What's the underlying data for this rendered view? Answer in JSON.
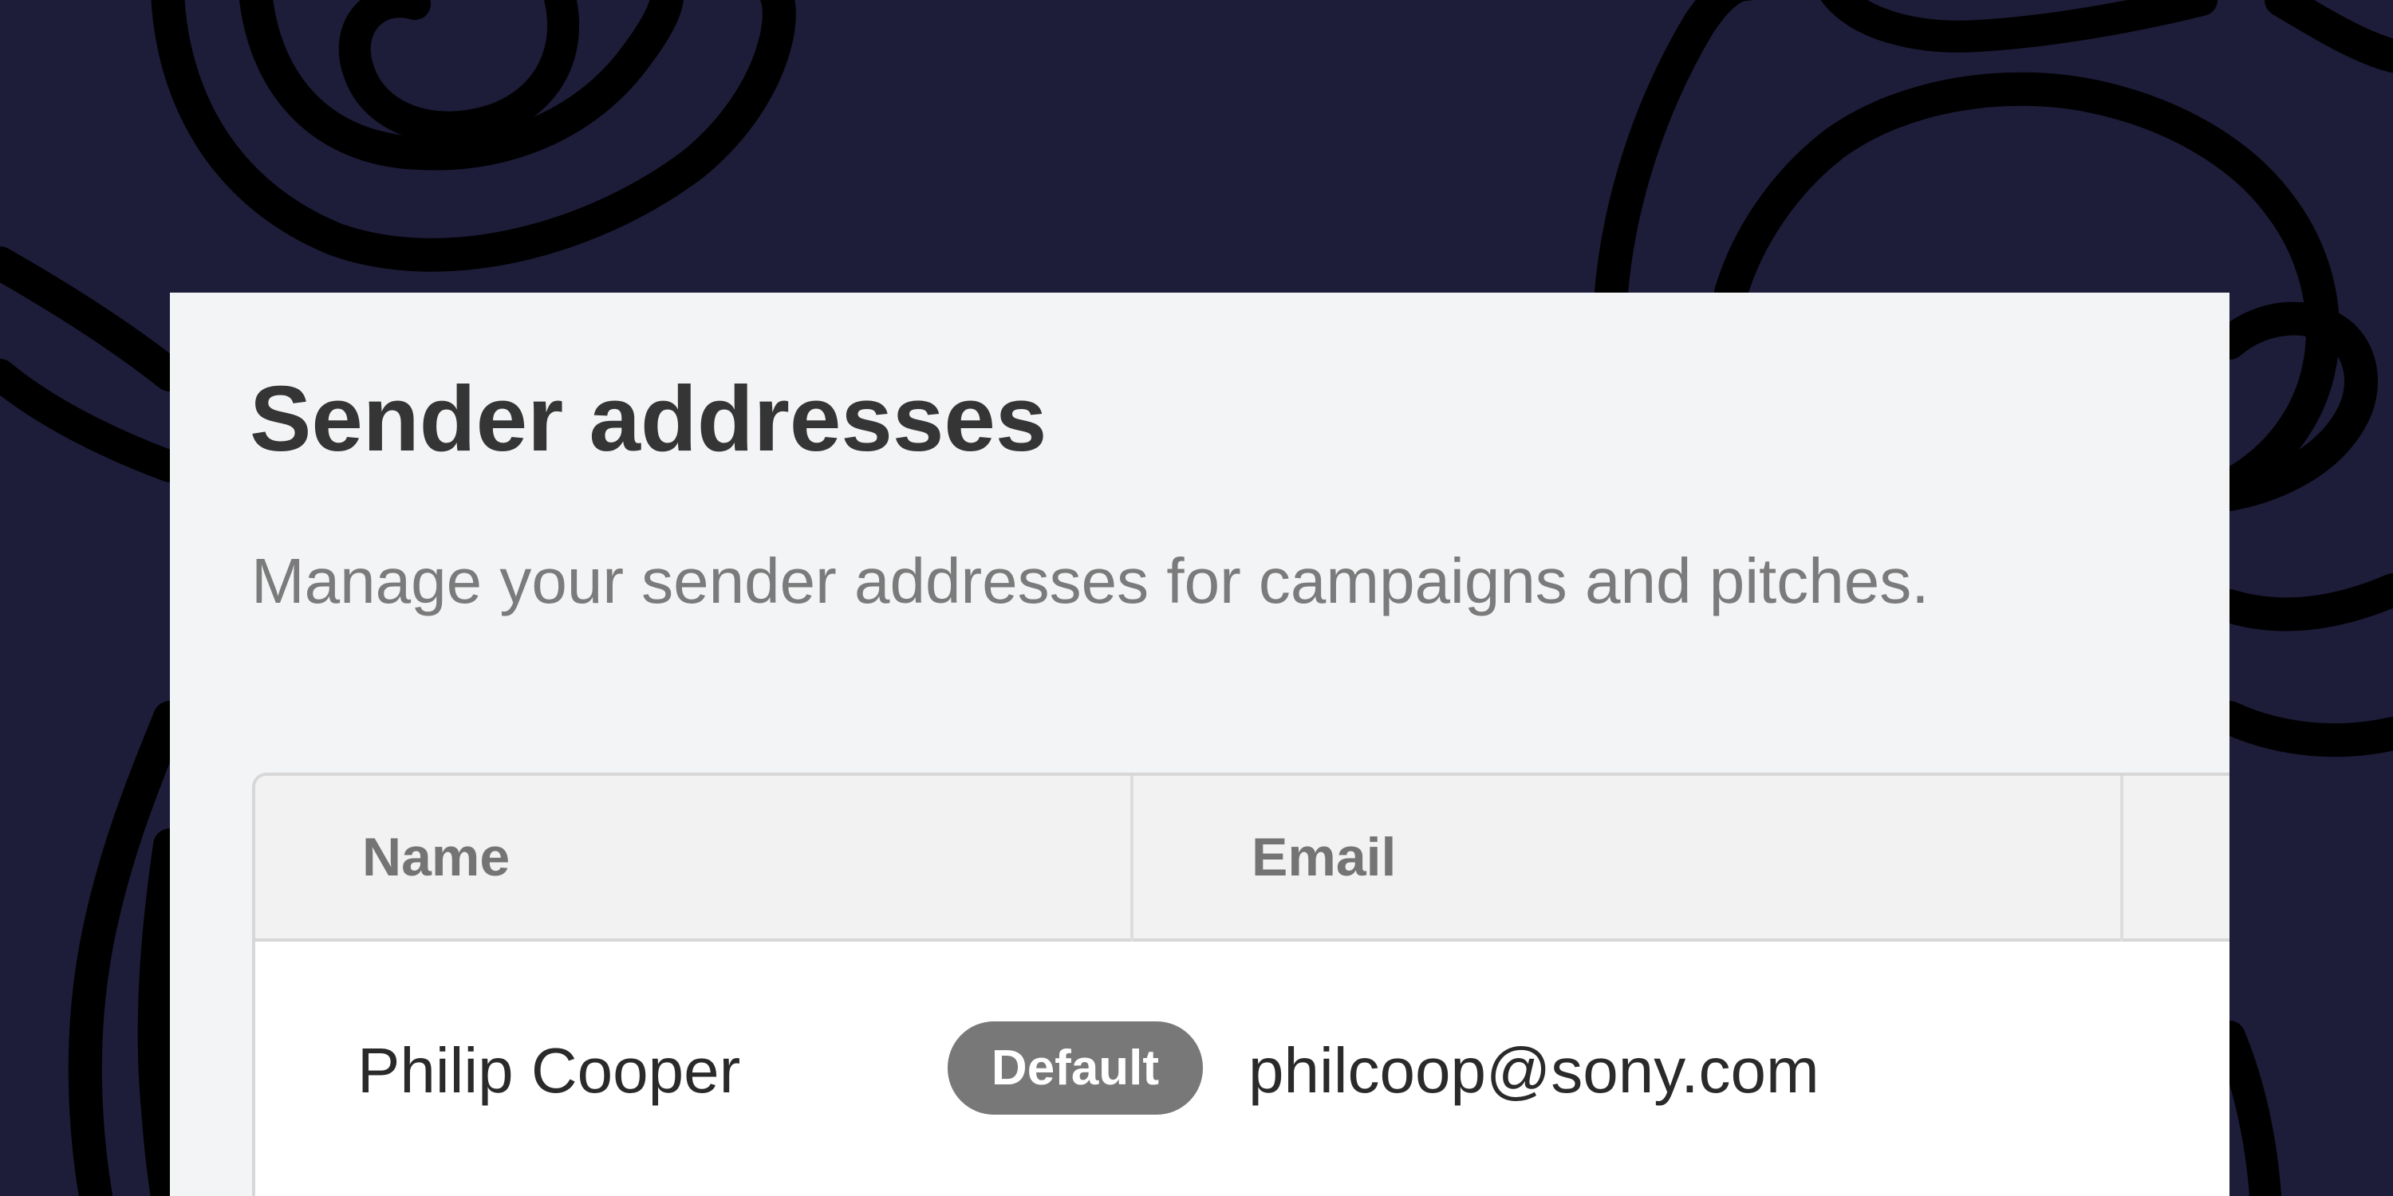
{
  "colors": {
    "background": "#1d1c39",
    "swirl": "#000000",
    "card": "#f3f4f6",
    "title": "#353535",
    "subtitle": "#7b7b7b",
    "badge": "#787878"
  },
  "card": {
    "title": "Sender addresses",
    "subtitle": "Manage your sender addresses for campaigns and pitches."
  },
  "table": {
    "columns": [
      "Name",
      "Email"
    ],
    "rows": [
      {
        "name": "Philip Cooper",
        "badge": "Default",
        "email": "philcoop@sony.com"
      }
    ]
  }
}
